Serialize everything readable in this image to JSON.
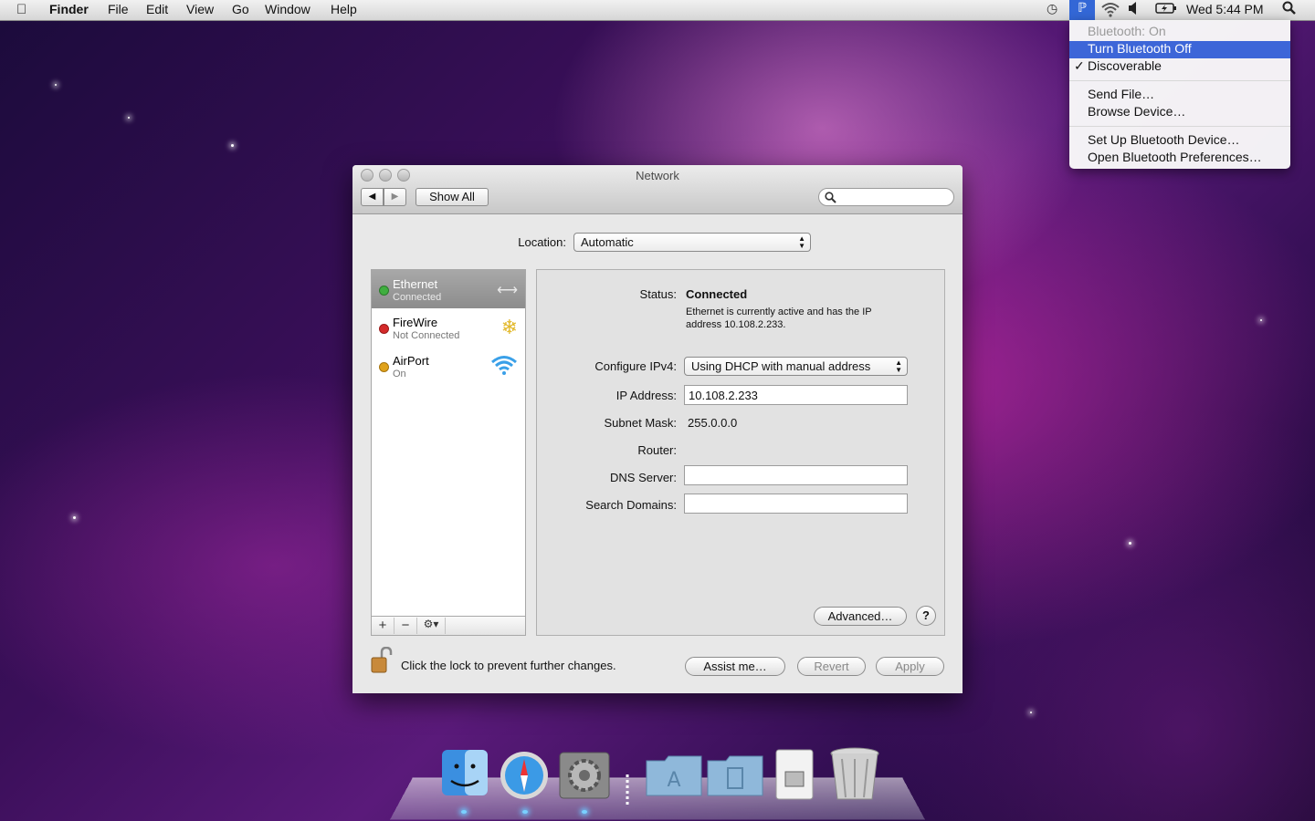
{
  "menubar": {
    "apple_icon": "",
    "app_name": "Finder",
    "items": [
      "File",
      "Edit",
      "View",
      "Go",
      "Window",
      "Help"
    ],
    "clock": "Wed 5:44 PM",
    "icons": [
      "time-machine-icon",
      "bluetooth-icon",
      "wifi-icon",
      "volume-icon",
      "battery-icon",
      "spotlight-icon"
    ]
  },
  "bluetooth_menu": {
    "status": "Bluetooth: On",
    "turn_off": "Turn Bluetooth Off",
    "discoverable": "Discoverable",
    "send_file": "Send File…",
    "browse_device": "Browse Device…",
    "setup_device": "Set Up Bluetooth Device…",
    "open_prefs": "Open Bluetooth Preferences…",
    "highlight_color": "#3d66d8"
  },
  "window": {
    "title": "Network",
    "show_all": "Show All",
    "search_placeholder": "",
    "location_label": "Location:",
    "location_value": "Automatic",
    "services": [
      {
        "name": "Ethernet",
        "status": "Connected",
        "dot": "#3fae3f"
      },
      {
        "name": "FireWire",
        "status": "Not Connected",
        "dot": "#d42a2a"
      },
      {
        "name": "AirPort",
        "status": "On",
        "dot": "#e0a21a"
      }
    ],
    "status_label": "Status:",
    "status_value": "Connected",
    "status_desc_line1": "Ethernet is currently active and has the IP",
    "status_desc_line2": "address 10.108.2.233.",
    "configure_label": "Configure IPv4:",
    "configure_value": "Using DHCP with manual address",
    "ip_label": "IP Address:",
    "ip_value": "10.108.2.233",
    "subnet_label": "Subnet Mask:",
    "subnet_value": "255.0.0.0",
    "router_label": "Router:",
    "dns_label": "DNS Server:",
    "dns_value": "",
    "search_domains_label": "Search Domains:",
    "search_domains_value": "",
    "advanced": "Advanced…",
    "help": "?",
    "lock_text": "Click the lock to prevent further changes.",
    "assist": "Assist me…",
    "revert": "Revert",
    "apply": "Apply",
    "list_add": "+",
    "list_remove": "−",
    "list_gear": "⚙▾"
  },
  "dock": {
    "items": [
      "finder-icon",
      "safari-icon",
      "system-preferences-icon",
      "applications-folder-icon",
      "documents-folder-icon",
      "downloads-stack-icon",
      "trash-icon"
    ]
  }
}
